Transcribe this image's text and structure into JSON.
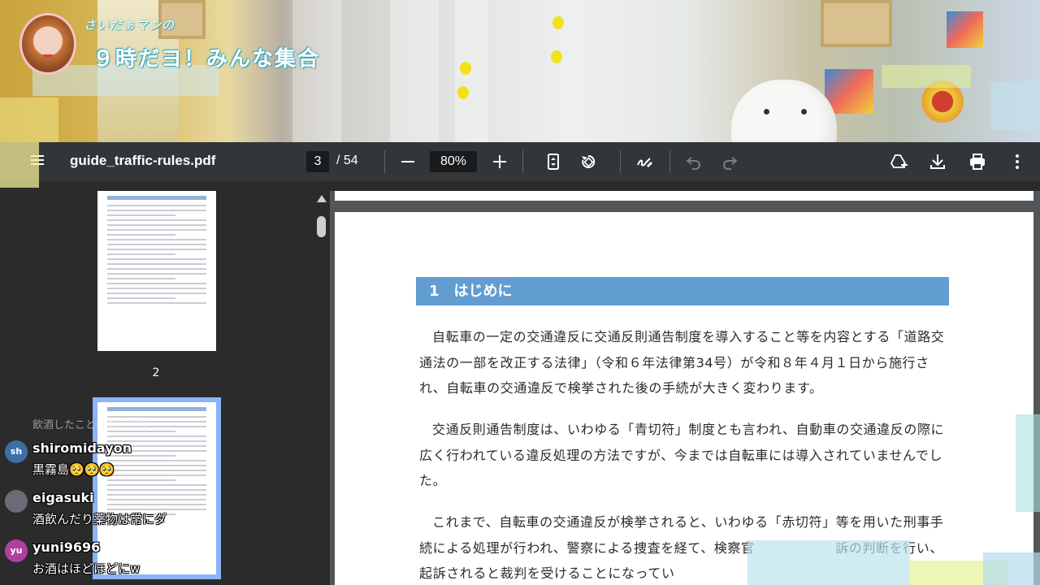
{
  "stream": {
    "subtitle": "さいだぁマンの",
    "title": "９時だヨ！みんな集合"
  },
  "viewer": {
    "filename": "guide_traffic-rules.pdf",
    "current_page": "3",
    "total_pages": "/ 54",
    "zoom": "80%",
    "icons": {
      "menu": "menu-icon",
      "zoom_out": "minus-icon",
      "zoom_in": "plus-icon",
      "fit": "fit-page-icon",
      "rotate": "rotate-icon",
      "annotate": "pen-icon",
      "undo": "undo-icon",
      "redo": "redo-icon",
      "drive": "add-to-drive-icon",
      "download": "download-icon",
      "print": "print-icon",
      "more": "more-vert-icon"
    }
  },
  "thumbnails": [
    {
      "label": "2"
    }
  ],
  "document": {
    "section_heading": "1　はじめに",
    "paragraphs": [
      "自転車の一定の交通違反に交通反則通告制度を導入すること等を内容とする「道路交通法の一部を改正する法律」（令和６年法律第34号）が令和８年４月１日から施行され、自転車の交通違反で検挙された後の手続が大きく変わります。",
      "交通反則通告制度は、いわゆる「青切符」制度とも言われ、自動車の交通違反の際に広く行われている違反処理の方法ですが、今までは自転車には導入されていませんでした。",
      "これまで、自転車の交通違反が検挙されると、いわゆる「赤切符」等を用いた刑事手続による処理が行われ、警察による捜査を経て、検察官　　　　　　訴の判断を行い、起訴されると裁判を受けることになってい"
    ]
  },
  "chat": [
    {
      "user": "shiromidayon",
      "initials": "sh",
      "message": "黒霧島🥺🥺🥺",
      "avatar_color": "#3d6fa6"
    },
    {
      "user": "eigasuki",
      "initials": "",
      "message": "酒飲んだり薬物は常にダ",
      "avatar_color": "#6b6b78"
    },
    {
      "user": "yuni9696",
      "initials": "yu",
      "message": "お酒はほどほどにw",
      "avatar_color": "#b23fa0"
    }
  ],
  "chat_faded_top": "飲酒したことはないかな"
}
